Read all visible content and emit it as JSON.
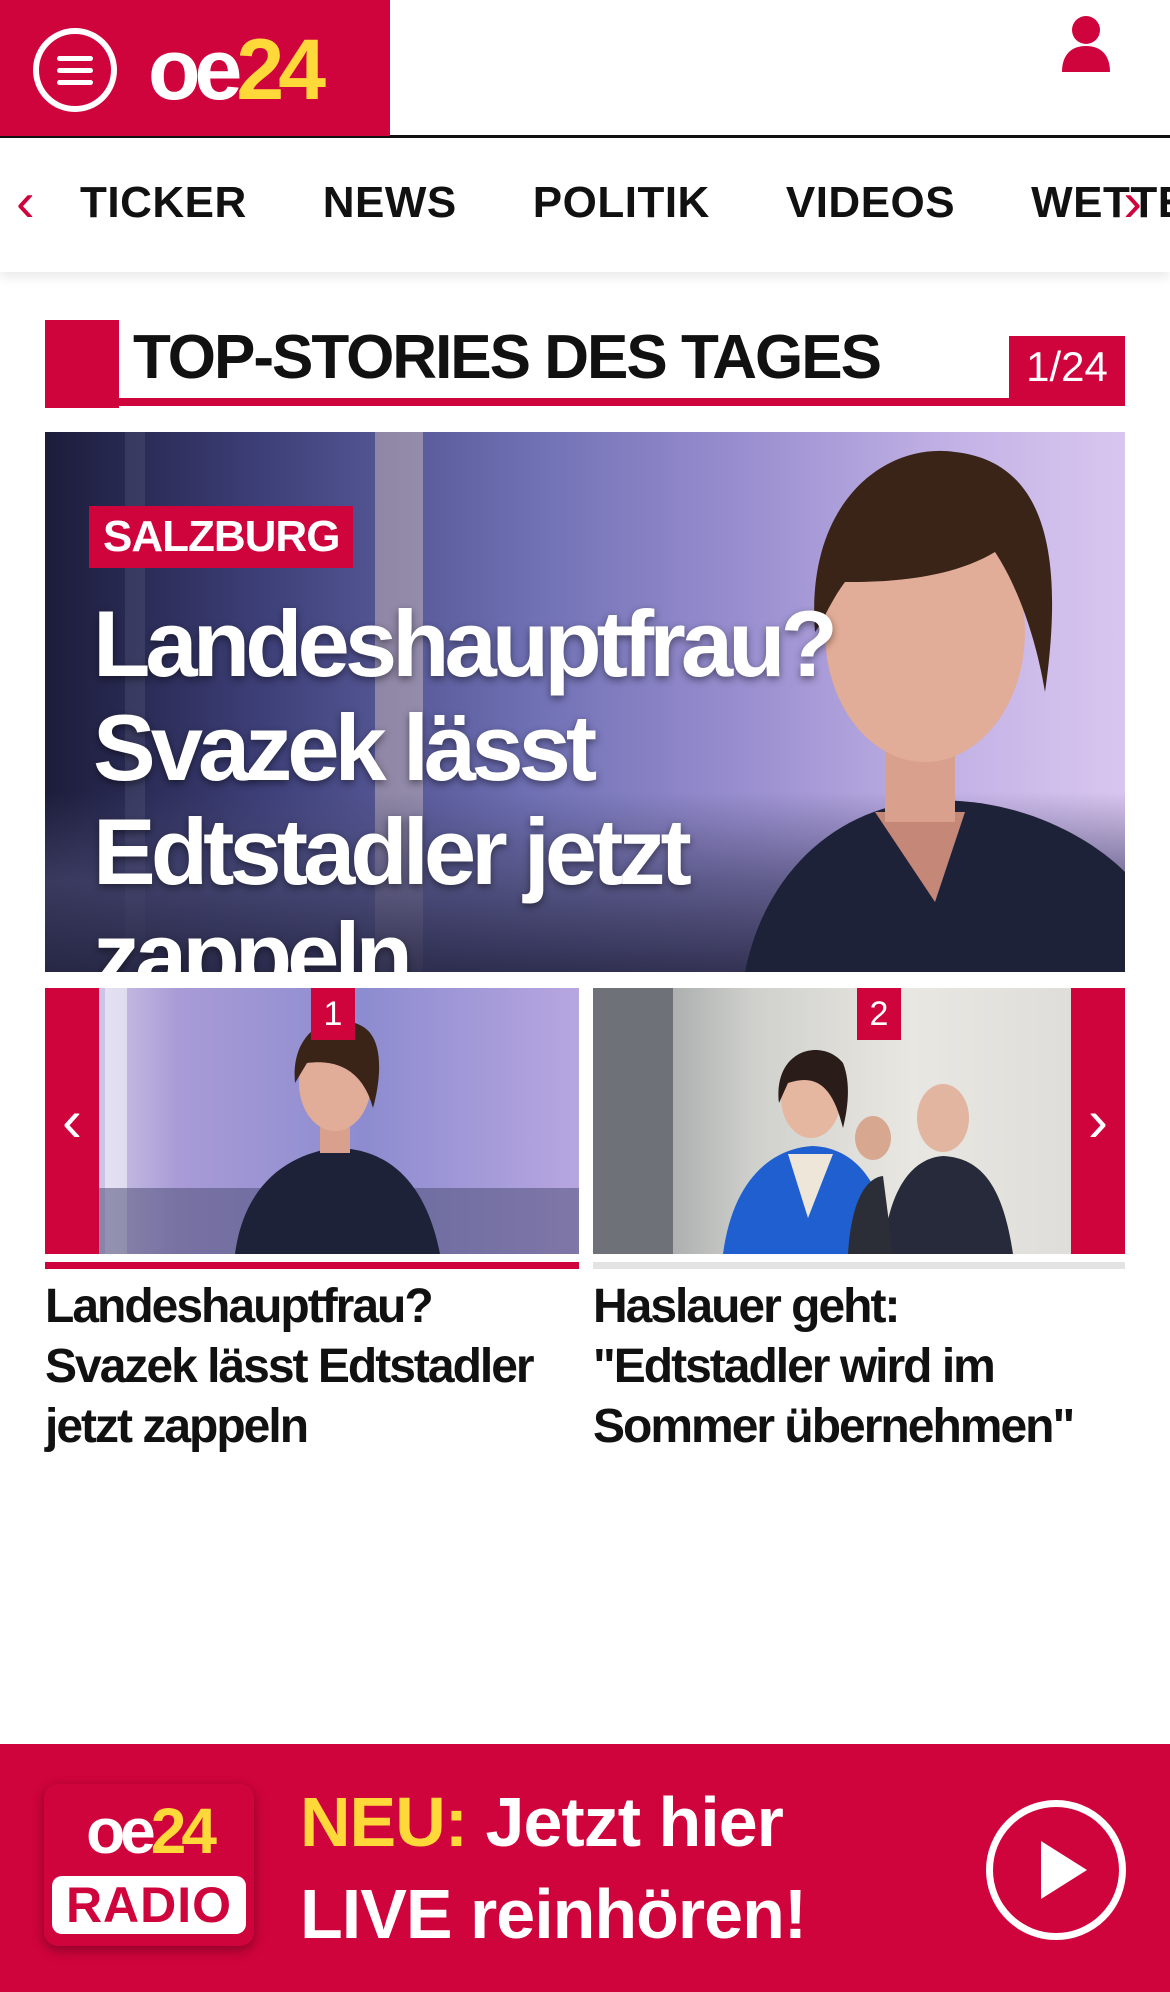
{
  "header": {
    "logo_oe": "oe",
    "logo_24": "24",
    "menu_icon": "hamburger-menu-icon",
    "user_icon": "user-icon"
  },
  "nav": {
    "left_arrow": "‹",
    "right_arrow": "›",
    "items": [
      {
        "label": "TICKER"
      },
      {
        "label": "NEWS"
      },
      {
        "label": "POLITIK"
      },
      {
        "label": "VIDEOS"
      },
      {
        "label": "WETTER"
      }
    ]
  },
  "section": {
    "title": "TOP-STORIES DES TAGES",
    "counter": "1/24"
  },
  "hero": {
    "kicker": "SALZBURG",
    "headline": "Landeshauptfrau? Svazek lässt Edtstadler jetzt zappeln"
  },
  "carousel": {
    "prev_arrow": "‹",
    "next_arrow": "›",
    "items": [
      {
        "number": "1",
        "title": "Landeshauptfrau? Svazek lässt Edtstadler jetzt zappeln",
        "active": true
      },
      {
        "number": "2",
        "title": "Haslauer geht: \"Edtstadler wird im Sommer übernehmen\"",
        "active": false
      }
    ]
  },
  "radio_banner": {
    "logo_oe": "oe",
    "logo_24": "24",
    "logo_badge": "RADIO",
    "neu_label": "NEU:",
    "line1_rest": " Jetzt hier",
    "line2": "LIVE reinhören!",
    "play_icon": "play-icon"
  },
  "colors": {
    "brand_red": "#d0043c",
    "brand_yellow": "#ffd83a",
    "text_dark": "#111111"
  }
}
